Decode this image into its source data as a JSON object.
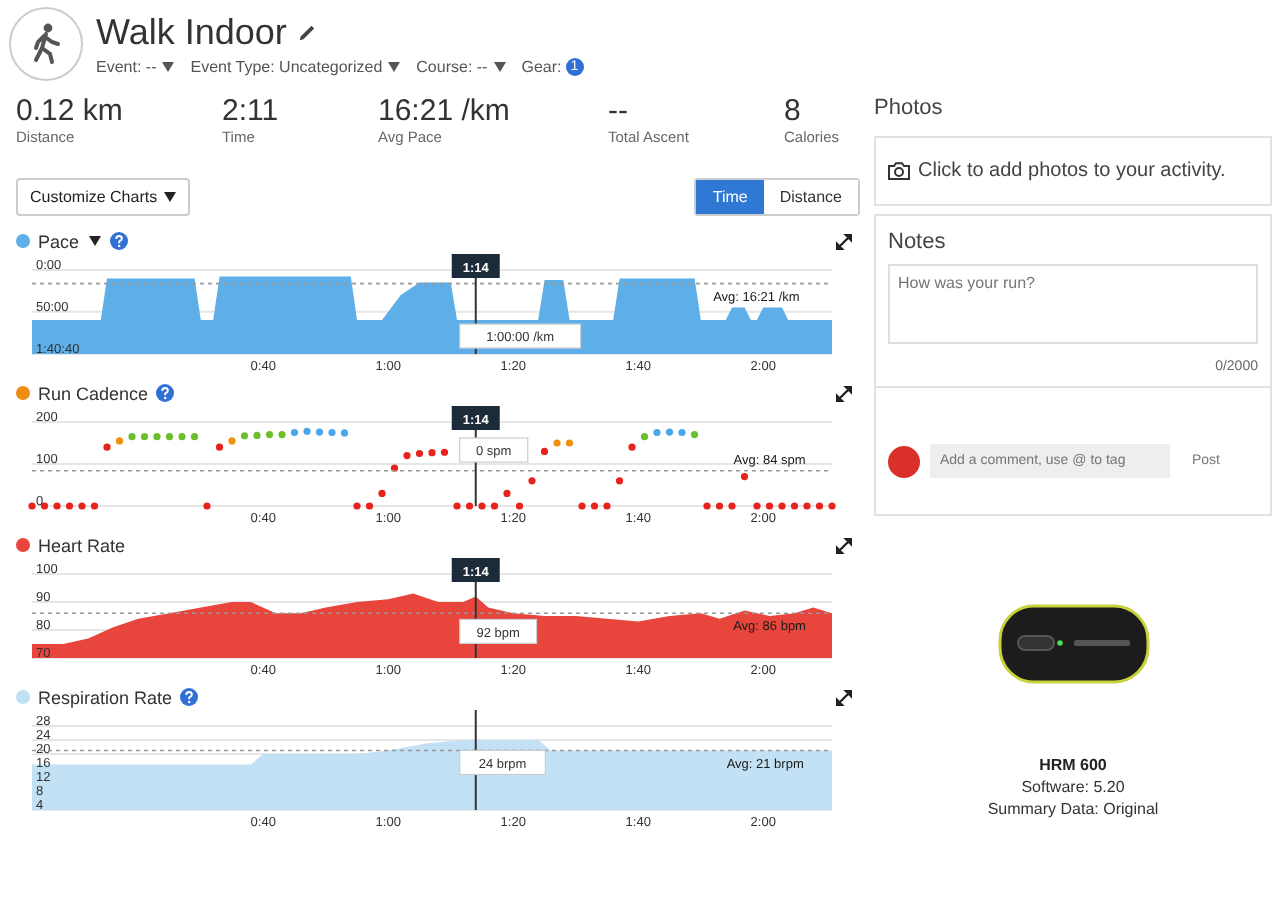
{
  "activity": {
    "title": "Walk Indoor",
    "meta": [
      {
        "label": "Event: --"
      },
      {
        "label": "Event Type: Uncategorized"
      },
      {
        "label": "Course: --"
      }
    ],
    "gear_label": "Gear:",
    "gear_count": "1"
  },
  "stats": [
    {
      "value": "0.12 km",
      "label": "Distance"
    },
    {
      "value": "2:11",
      "label": "Time"
    },
    {
      "value": "16:21 /km",
      "label": "Avg Pace"
    },
    {
      "value": "--",
      "label": "Total Ascent"
    },
    {
      "value": "8",
      "label": "Calories"
    }
  ],
  "customize_button": "Customize Charts",
  "axis_toggle": [
    {
      "label": "Time",
      "selected": true
    },
    {
      "label": "Distance",
      "selected": false
    }
  ],
  "charts": [
    {
      "color": "#5eaee8",
      "header_icons": [
        {
          "kind": "dropdown"
        },
        {
          "kind": "help"
        }
      ],
      "cursor_time": "1:14",
      "cursor_reading": "1:00:00 /km",
      "chart_data": {
        "type": "area",
        "x": [
          3,
          3,
          14,
          15,
          29,
          30,
          32,
          33,
          54,
          55,
          59,
          62,
          65,
          70,
          71,
          84,
          85,
          88,
          89,
          96,
          97,
          109,
          110,
          114,
          115,
          117,
          118,
          119,
          120,
          123,
          124,
          131,
          131
        ],
        "series": [
          {
            "name": "Pace",
            "color": "#5eaee8",
            "values": [
              100.67,
              60,
              60,
              10,
              10,
              60,
              60,
              8,
              8,
              60,
              60,
              30,
              15,
              15,
              60,
              60,
              12,
              12,
              60,
              60,
              10,
              10,
              60,
              60,
              45,
              45,
              60,
              60,
              45,
              45,
              60,
              60,
              100.67
            ]
          }
        ],
        "xlim": [
          3,
          131
        ],
        "ylim": [
          100.67,
          0
        ],
        "xticks": [
          {
            "value": 40,
            "label": "0:40"
          },
          {
            "value": 60,
            "label": "1:00"
          },
          {
            "value": 80,
            "label": "1:20"
          },
          {
            "value": 100,
            "label": "1:40"
          },
          {
            "value": 120,
            "label": "2:00"
          }
        ],
        "yticks": [
          {
            "value": 0,
            "label": "0:00"
          },
          {
            "value": 50,
            "label": "50:00"
          },
          {
            "value": 100.67,
            "label": "1:40:40"
          }
        ],
        "ref_lines": [
          {
            "axis": "y",
            "value": 16.35,
            "label": "Avg: 16:21 /km"
          },
          {
            "axis": "x",
            "value": 74
          }
        ]
      }
    },
    {
      "title": "Run Cadence",
      "color": "#ef8c14",
      "header_icons": [
        {
          "kind": "help"
        }
      ],
      "cursor_time": "1:14",
      "cursor_reading": "0 spm",
      "chart_data": {
        "type": "scatter",
        "x": [
          3,
          5,
          7,
          9,
          11,
          13,
          15,
          17,
          19,
          21,
          23,
          25,
          27,
          29,
          31,
          33,
          35,
          37,
          39,
          41,
          43,
          45,
          47,
          49,
          51,
          53,
          55,
          57,
          59,
          61,
          63,
          65,
          67,
          69,
          71,
          73,
          75,
          77,
          79,
          81,
          83,
          85,
          87,
          89,
          91,
          93,
          95,
          97,
          99,
          101,
          103,
          105,
          107,
          109,
          111,
          113,
          115,
          117,
          119,
          121,
          123,
          125,
          127,
          129,
          131
        ],
        "series": [
          {
            "color": "#e8231c",
            "values": [
              0,
              0,
              0,
              0,
              0,
              0,
              140,
              null,
              null,
              null,
              null,
              null,
              null,
              null,
              0,
              140,
              null,
              null,
              null,
              null,
              null,
              null,
              null,
              null,
              null,
              null,
              0,
              0,
              30,
              90,
              120,
              125,
              127,
              128,
              0,
              0,
              0,
              0,
              30,
              0,
              60,
              130,
              null,
              null,
              0,
              0,
              0,
              60,
              140,
              null,
              null,
              null,
              null,
              null,
              0,
              0,
              0,
              70,
              0,
              0,
              0,
              0,
              0,
              0,
              0
            ]
          },
          {
            "color": "#f0900c",
            "values": [
              null,
              null,
              null,
              null,
              null,
              null,
              null,
              155,
              null,
              null,
              null,
              null,
              null,
              null,
              null,
              null,
              155,
              null,
              null,
              null,
              null,
              null,
              null,
              null,
              null,
              null,
              null,
              null,
              null,
              null,
              null,
              null,
              null,
              null,
              null,
              null,
              null,
              null,
              null,
              null,
              null,
              null,
              150,
              150,
              null,
              null,
              null,
              null,
              null,
              null,
              null,
              null,
              null,
              null,
              null,
              null,
              null,
              null,
              null,
              null,
              null,
              null,
              null,
              null,
              null
            ]
          },
          {
            "color": "#6cbf2a",
            "values": [
              null,
              null,
              null,
              null,
              null,
              null,
              null,
              null,
              165,
              165,
              165,
              165,
              165,
              165,
              null,
              null,
              null,
              167,
              168,
              170,
              170,
              null,
              null,
              null,
              null,
              null,
              null,
              null,
              null,
              null,
              null,
              null,
              null,
              null,
              null,
              null,
              null,
              null,
              null,
              null,
              null,
              null,
              null,
              null,
              null,
              null,
              null,
              null,
              null,
              165,
              null,
              null,
              null,
              170,
              null,
              null,
              null,
              null,
              null,
              null,
              null,
              null,
              null,
              null,
              null
            ]
          },
          {
            "color": "#4aa6ea",
            "values": [
              null,
              null,
              null,
              null,
              null,
              null,
              null,
              null,
              null,
              null,
              null,
              null,
              null,
              null,
              null,
              null,
              null,
              null,
              null,
              null,
              null,
              175,
              178,
              176,
              175,
              174,
              null,
              null,
              null,
              null,
              null,
              null,
              null,
              null,
              null,
              null,
              null,
              null,
              null,
              null,
              null,
              null,
              null,
              null,
              null,
              null,
              null,
              null,
              null,
              null,
              175,
              176,
              175,
              null,
              null,
              null,
              null,
              null,
              null,
              null,
              null,
              null,
              null,
              null,
              null
            ]
          }
        ],
        "xlim": [
          3,
          131
        ],
        "ylim": [
          0,
          200
        ],
        "xticks": [
          {
            "value": 40,
            "label": "0:40"
          },
          {
            "value": 60,
            "label": "1:00"
          },
          {
            "value": 80,
            "label": "1:20"
          },
          {
            "value": 100,
            "label": "1:40"
          },
          {
            "value": 120,
            "label": "2:00"
          }
        ],
        "yticks": [
          0,
          100,
          200
        ],
        "ref_lines": [
          {
            "axis": "y",
            "value": 84,
            "label": "Avg: 84 spm"
          },
          {
            "axis": "x",
            "value": 74
          }
        ]
      }
    },
    {
      "color": "#e8453c",
      "cursor_time": "1:14",
      "cursor_reading": "92 bpm",
      "chart_data": {
        "type": "area",
        "x": [
          3,
          8,
          12,
          16,
          20,
          25,
          30,
          35,
          38,
          42,
          46,
          50,
          55,
          60,
          64,
          68,
          72,
          74,
          76,
          80,
          85,
          90,
          95,
          100,
          105,
          110,
          113,
          117,
          121,
          125,
          128,
          131
        ],
        "series": [
          {
            "name": "Heart Rate",
            "color": "#e8453c",
            "values": [
              75,
              75,
              77,
              81,
              84,
              86,
              88,
              90,
              90,
              86,
              86,
              88,
              90,
              91,
              93,
              90,
              90,
              92,
              88,
              86,
              85,
              85,
              84,
              83,
              85,
              86,
              84,
              87,
              85,
              86,
              88,
              86
            ]
          }
        ],
        "xlim": [
          3,
          131
        ],
        "ylim": [
          70,
          100
        ],
        "xticks": [
          {
            "value": 40,
            "label": "0:40"
          },
          {
            "value": 60,
            "label": "1:00"
          },
          {
            "value": 80,
            "label": "1:20"
          },
          {
            "value": 100,
            "label": "1:40"
          },
          {
            "value": 120,
            "label": "2:00"
          }
        ],
        "yticks": [
          70,
          80,
          90,
          100
        ],
        "ref_lines": [
          {
            "axis": "y",
            "value": 86,
            "label": "Avg: 86 bpm"
          },
          {
            "axis": "x",
            "value": 74
          }
        ]
      }
    },
    {
      "color": "#bfe0f5",
      "header_icons": [
        {
          "kind": "help"
        }
      ],
      "cursor_reading": "24 brpm",
      "chart_data": {
        "type": "area",
        "x": [
          3,
          30,
          38,
          40,
          55,
          60,
          66,
          72,
          80,
          84,
          86,
          95,
          131
        ],
        "series": [
          {
            "name": "Respiration Rate",
            "color": "#c3e1f5",
            "values": [
              17,
              17,
              17,
              20,
              20,
              21,
              23,
              24,
              24,
              24,
              21,
              21,
              21
            ]
          }
        ],
        "xlim": [
          3,
          131
        ],
        "ylim": [
          4,
          28
        ],
        "xticks": [
          {
            "value": 40,
            "label": "0:40"
          },
          {
            "value": 60,
            "label": "1:00"
          },
          {
            "value": 80,
            "label": "1:20"
          },
          {
            "value": 100,
            "label": "1:40"
          },
          {
            "value": 120,
            "label": "2:00"
          }
        ],
        "yticks": [
          4,
          8,
          12,
          16,
          20,
          24,
          28
        ],
        "ref_lines": [
          {
            "axis": "y",
            "value": 21,
            "label": "Avg: 21 brpm"
          },
          {
            "axis": "x",
            "value": 74
          }
        ]
      }
    }
  ],
  "photos": {
    "heading": "Photos",
    "prompt": "Click to add photos to your activity."
  },
  "notes": {
    "heading": "Notes",
    "placeholder": "How was your run?",
    "counter": "0/2000"
  },
  "comment": {
    "placeholder": "Add a comment, use @ to tag",
    "post": "Post"
  },
  "device": {
    "name": "HRM 600",
    "software": "Software: 5.20",
    "summary": "Summary Data: Original"
  }
}
